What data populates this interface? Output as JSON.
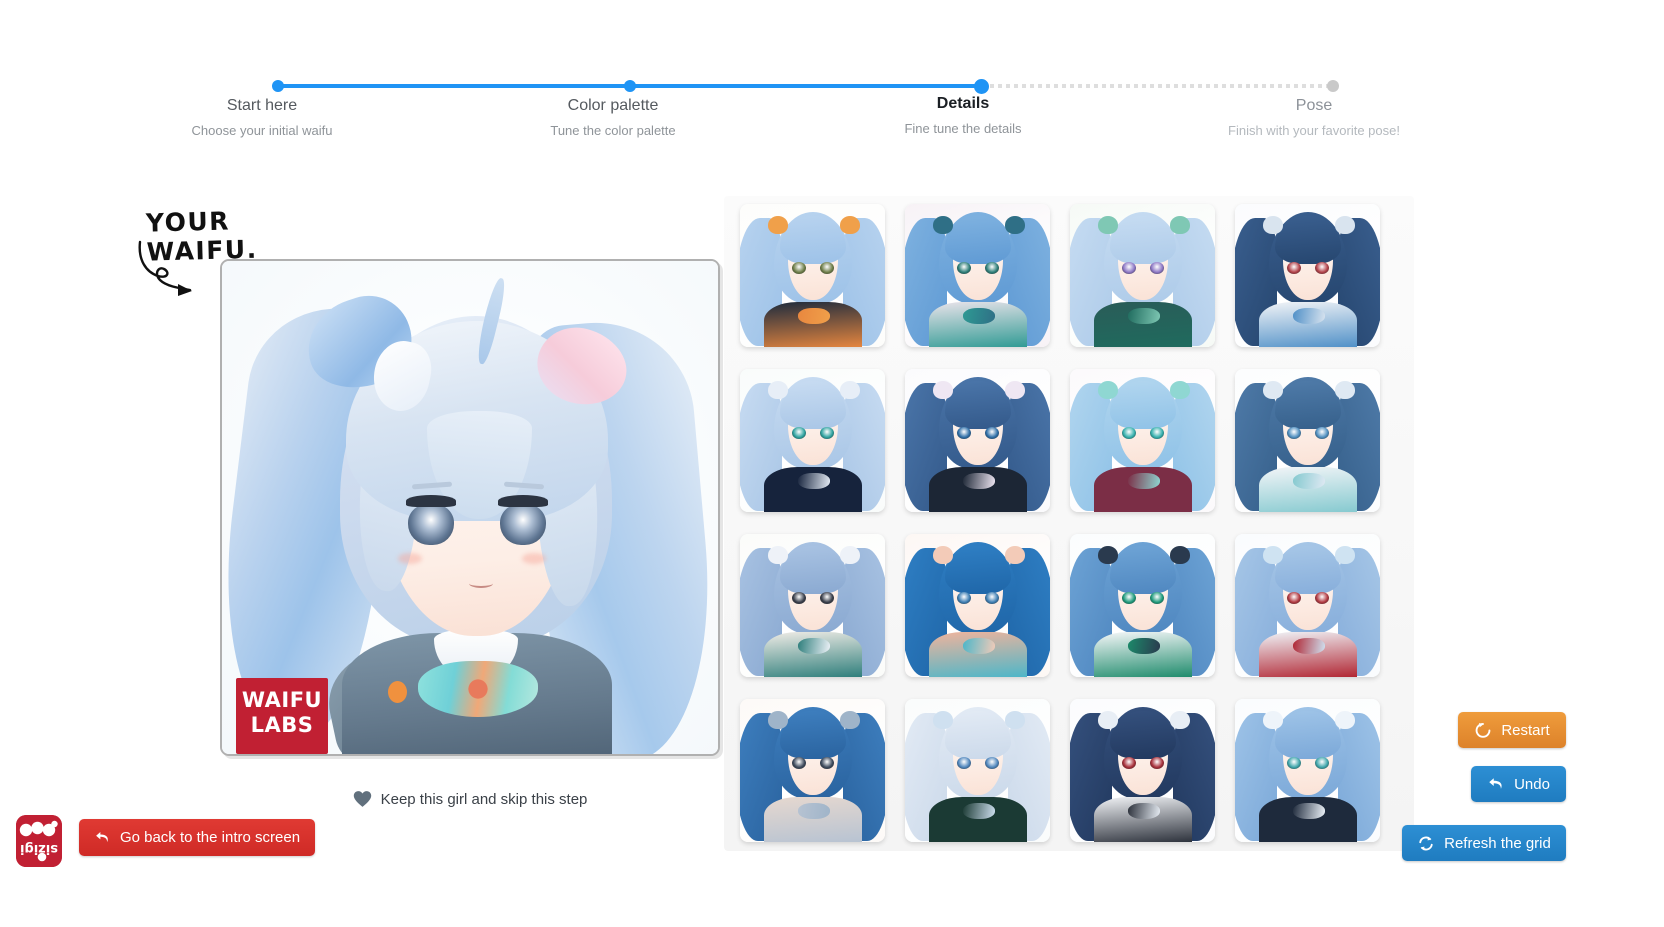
{
  "app": {
    "brand": "sizigi",
    "watermark_line1": "WAIFU",
    "watermark_line2": "LABS"
  },
  "stepper": {
    "accent_color": "#1f94f5",
    "inactive_color": "#c9c9c9",
    "steps": [
      {
        "title": "Start here",
        "subtitle": "Choose your initial waifu",
        "state": "done"
      },
      {
        "title": "Color palette",
        "subtitle": "Tune the color palette",
        "state": "done"
      },
      {
        "title": "Details",
        "subtitle": "Fine tune the details",
        "state": "current"
      },
      {
        "title": "Pose",
        "subtitle": "Finish with your favorite pose!",
        "state": "future"
      }
    ]
  },
  "preview": {
    "callout": "YOUR WAIFU.",
    "keep_label": "Keep this girl and skip this step",
    "heart_icon": "heart-icon",
    "heart_color": "#61707d"
  },
  "footer": {
    "back_label": "Go back to the intro screen",
    "back_icon": "undo-arrow-icon",
    "back_color": "#cf2a26"
  },
  "actions": [
    {
      "id": "restart",
      "label": "Restart",
      "icon": "restart-icon",
      "color": "#e08a2e"
    },
    {
      "id": "undo",
      "label": "Undo",
      "icon": "undo-arrow-icon",
      "color": "#1f7cc0"
    },
    {
      "id": "refresh",
      "label": "Refresh the grid",
      "icon": "sync-icon",
      "color": "#1f7cc0"
    }
  ],
  "grid": {
    "columns": 4,
    "rows": 4,
    "count": 16,
    "thumbnails": [
      {
        "id": 1,
        "hair": "#b8d3ef",
        "hair2": "#9dc2e8",
        "accent": "#e8873f",
        "outfit": "#1d2b3d",
        "eye": "#6f7f4a",
        "acc": "#f0a04a",
        "bg": "#fdfdfb"
      },
      {
        "id": 2,
        "hair": "#7fb2e0",
        "hair2": "#5f9ad4",
        "accent": "#2e9a93",
        "outfit": "#e9e3ea",
        "eye": "#2f7f79",
        "acc": "#2f6f86",
        "bg": "#f7f2f6"
      },
      {
        "id": 3,
        "hair": "#c6dcf2",
        "hair2": "#aecbe9",
        "accent": "#1f6b5e",
        "outfit": "#2a5c58",
        "eye": "#8e78c6",
        "acc": "#7fc8b4",
        "bg": "#f6faf6"
      },
      {
        "id": 4,
        "hair": "#3a5f8f",
        "hair2": "#26466f",
        "accent": "#4e8fc7",
        "outfit": "#f2f4f7",
        "eye": "#b3424a",
        "acc": "#d9e4ef",
        "bg": "#fbfcfe"
      },
      {
        "id": 5,
        "hair": "#c8dcf2",
        "hair2": "#a9c6e6",
        "accent": "#16233c",
        "outfit": "#16233c",
        "eye": "#2fa3a0",
        "acc": "#e7eef7",
        "bg": "#f9fcfb"
      },
      {
        "id": 6,
        "hair": "#4b76aa",
        "hair2": "#33598a",
        "accent": "#1c2635",
        "outfit": "#1c2635",
        "eye": "#2f6fa8",
        "acc": "#efe7f3",
        "bg": "#fbfbfd"
      },
      {
        "id": 7,
        "hair": "#b2d6ef",
        "hair2": "#8fc2e7",
        "accent": "#7b2e46",
        "outfit": "#7b2e46",
        "eye": "#35b0ad",
        "acc": "#8fd7d2",
        "bg": "#fcfafc"
      },
      {
        "id": 8,
        "hair": "#4f7ba9",
        "hair2": "#36608b",
        "accent": "#84c9cf",
        "outfit": "#f3f5f8",
        "eye": "#4f8fc0",
        "acc": "#dfe9f3",
        "bg": "#fcfdfe"
      },
      {
        "id": 9,
        "hair": "#a9c3e3",
        "hair2": "#8aa9d1",
        "accent": "#2c7d7a",
        "outfit": "#f0ece6",
        "eye": "#3a3f4b",
        "acc": "#eef2f8",
        "bg": "#fbfcfa"
      },
      {
        "id": 10,
        "hair": "#2f7fc4",
        "hair2": "#1f66a8",
        "accent": "#4bb6c9",
        "outfit": "#f0b49c",
        "eye": "#3f7fb4",
        "acc": "#f3cbb8",
        "bg": "#fdf7f4"
      },
      {
        "id": 11,
        "hair": "#6ea4d6",
        "hair2": "#4f87c0",
        "accent": "#1c8a6a",
        "outfit": "#f6f7f9",
        "eye": "#1f9b7c",
        "acc": "#2a3a4e",
        "bg": "#fbfdfe"
      },
      {
        "id": 12,
        "hair": "#a7c7e7",
        "hair2": "#87aedb",
        "accent": "#b02330",
        "outfit": "#f0f4f8",
        "eye": "#b23a42",
        "acc": "#cfe3f2",
        "bg": "#fafcfe"
      },
      {
        "id": 13,
        "hair": "#3e7fbf",
        "hair2": "#2a639f",
        "accent": "#b7c3d2",
        "outfit": "#e6d8cf",
        "eye": "#3d4a5c",
        "acc": "#9fb4c9",
        "bg": "#fdfaf7"
      },
      {
        "id": 14,
        "hair": "#e3ebf5",
        "hair2": "#cbd9ea",
        "accent": "#1b3a34",
        "outfit": "#1b3a34",
        "eye": "#4f86bd",
        "acc": "#cfe0f0",
        "bg": "#fafcfc"
      },
      {
        "id": 15,
        "hair": "#35517e",
        "hair2": "#22395f",
        "accent": "#2a2f39",
        "outfit": "#f1f3f6",
        "eye": "#a8303a",
        "acc": "#e8eef5",
        "bg": "#fbfcfe"
      },
      {
        "id": 16,
        "hair": "#9fc4e8",
        "hair2": "#7ba8d8",
        "accent": "#1e2a3c",
        "outfit": "#1e2a3c",
        "eye": "#3fa6ab",
        "acc": "#eef4fa",
        "bg": "#fafcfe"
      }
    ]
  }
}
